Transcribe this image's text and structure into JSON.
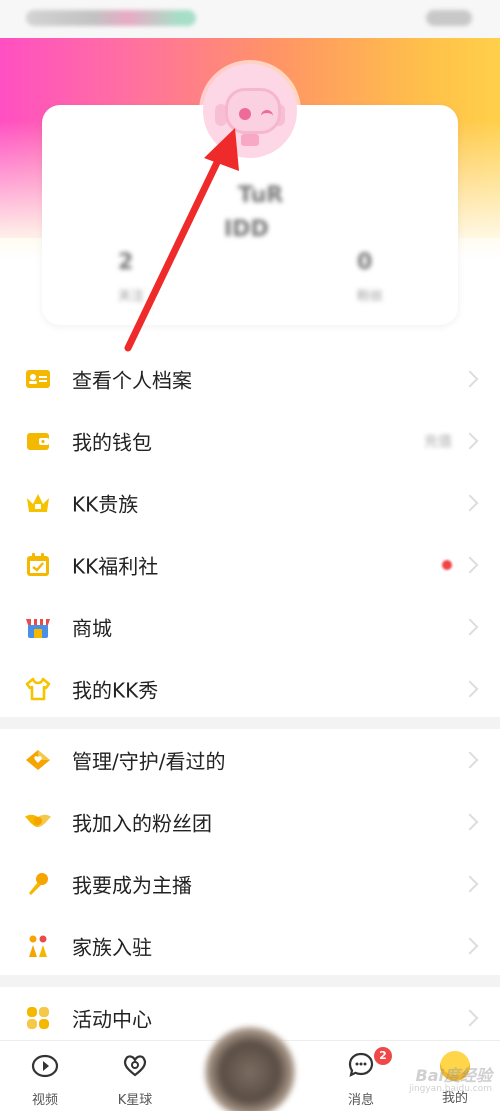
{
  "profile": {
    "name": "TuR",
    "id": "IDD",
    "stats": [
      {
        "value": "2",
        "label": "关注"
      },
      {
        "value": "0",
        "label": "粉丝"
      }
    ]
  },
  "menu_group1": [
    {
      "label": "查看个人档案",
      "icon": "id-card-icon",
      "color": "#f5b800"
    },
    {
      "label": "我的钱包",
      "icon": "wallet-icon",
      "color": "#f5b800",
      "side": "充值"
    },
    {
      "label": "KK贵族",
      "icon": "crown-icon",
      "color": "#f5c300"
    },
    {
      "label": "KK福利社",
      "icon": "calendar-check-icon",
      "color": "#f5b800",
      "red_dot": true
    },
    {
      "label": "商城",
      "icon": "store-icon",
      "color": "#e94b4b"
    },
    {
      "label": "我的KK秀",
      "icon": "tshirt-icon",
      "color": "#f5c300"
    }
  ],
  "menu_group2": [
    {
      "label": "管理/守护/看过的",
      "icon": "heart-diamond-icon",
      "color": "#f5a400"
    },
    {
      "label": "我加入的粉丝团",
      "icon": "wings-icon",
      "color": "#f5b800"
    },
    {
      "label": "我要成为主播",
      "icon": "microphone-icon",
      "color": "#f5a400"
    },
    {
      "label": "家族入驻",
      "icon": "family-icon",
      "color": "#f5a400"
    }
  ],
  "menu_group3": [
    {
      "label": "活动中心",
      "icon": "activity-grid-icon",
      "color": "#f5b800"
    }
  ],
  "bottom_nav": {
    "video": "视频",
    "kstar": "K星球",
    "message": "消息",
    "message_badge": "2",
    "mine": "我的"
  },
  "watermark": {
    "main": "Bai度经验",
    "sub": "jingyan.baidu.com"
  }
}
